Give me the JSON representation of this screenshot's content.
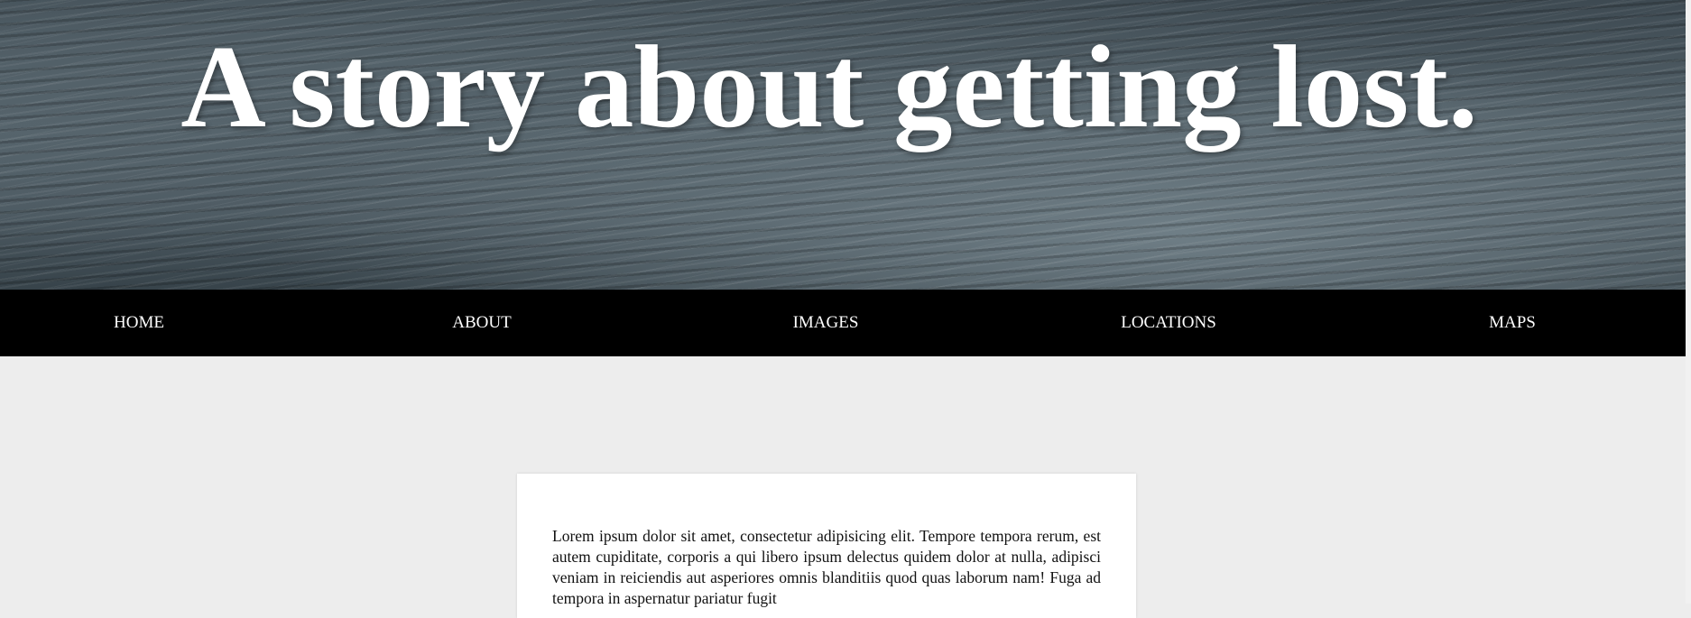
{
  "hero": {
    "title": "A story about getting lost."
  },
  "nav": {
    "items": [
      {
        "label": "HOME"
      },
      {
        "label": "ABOUT"
      },
      {
        "label": "IMAGES"
      },
      {
        "label": "LOCATIONS"
      },
      {
        "label": "MAPS"
      }
    ]
  },
  "content": {
    "paragraph": "Lorem ipsum dolor sit amet, consectetur adipisicing elit. Tempore tempora rerum, est autem cupiditate, corporis a qui libero ipsum delectus quidem dolor at nulla, adipisci veniam in reiciendis aut asperiores omnis blanditiis quod quas laborum nam! Fuga ad tempora in aspernatur pariatur fugit"
  },
  "colors": {
    "nav_background": "#000000",
    "page_background": "#ededed",
    "card_background": "#ffffff",
    "title_text": "#ffffff"
  }
}
